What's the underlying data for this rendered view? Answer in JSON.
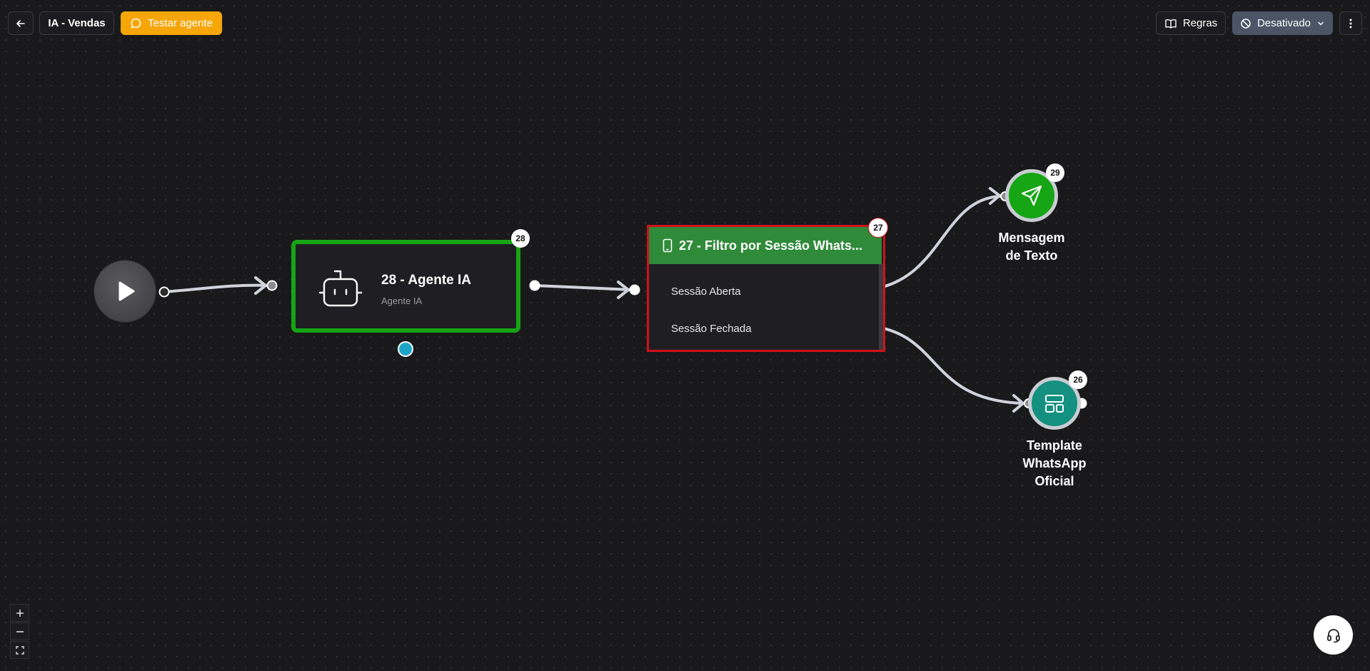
{
  "header": {
    "title": "IA - Vendas",
    "test_label": "Testar agente",
    "rules_label": "Regras",
    "status_label": "Desativado"
  },
  "nodes": {
    "agent": {
      "badge": "28",
      "title": "28 - Agente IA",
      "subtitle": "Agente IA"
    },
    "filter": {
      "badge": "27",
      "title": "27 - Filtro por Sessão Whats...",
      "outputs": [
        "Sessão Aberta",
        "Sessão Fechada"
      ]
    },
    "message": {
      "badge": "29",
      "label_line1": "Mensagem",
      "label_line2": "de Texto"
    },
    "template": {
      "badge": "26",
      "label_line1": "Template",
      "label_line2": "WhatsApp",
      "label_line3": "Oficial"
    }
  },
  "colors": {
    "canvas": "#19191c",
    "accent_orange": "#f6a609",
    "agent_border": "#16a515",
    "filter_header": "#2f8a39",
    "filter_selected_border": "#d0111b",
    "message_node": "#16a515",
    "template_node": "#13907f",
    "handle_blue": "#1ba6c8"
  },
  "icons": [
    "back-arrow-icon",
    "chat-icon",
    "book-icon",
    "ban-icon",
    "chevron-down-icon",
    "more-vertical-icon",
    "play-icon",
    "robot-icon",
    "smartphone-icon",
    "send-icon",
    "layout-template-icon",
    "plus-icon",
    "minus-icon",
    "fullscreen-icon",
    "headset-icon"
  ]
}
